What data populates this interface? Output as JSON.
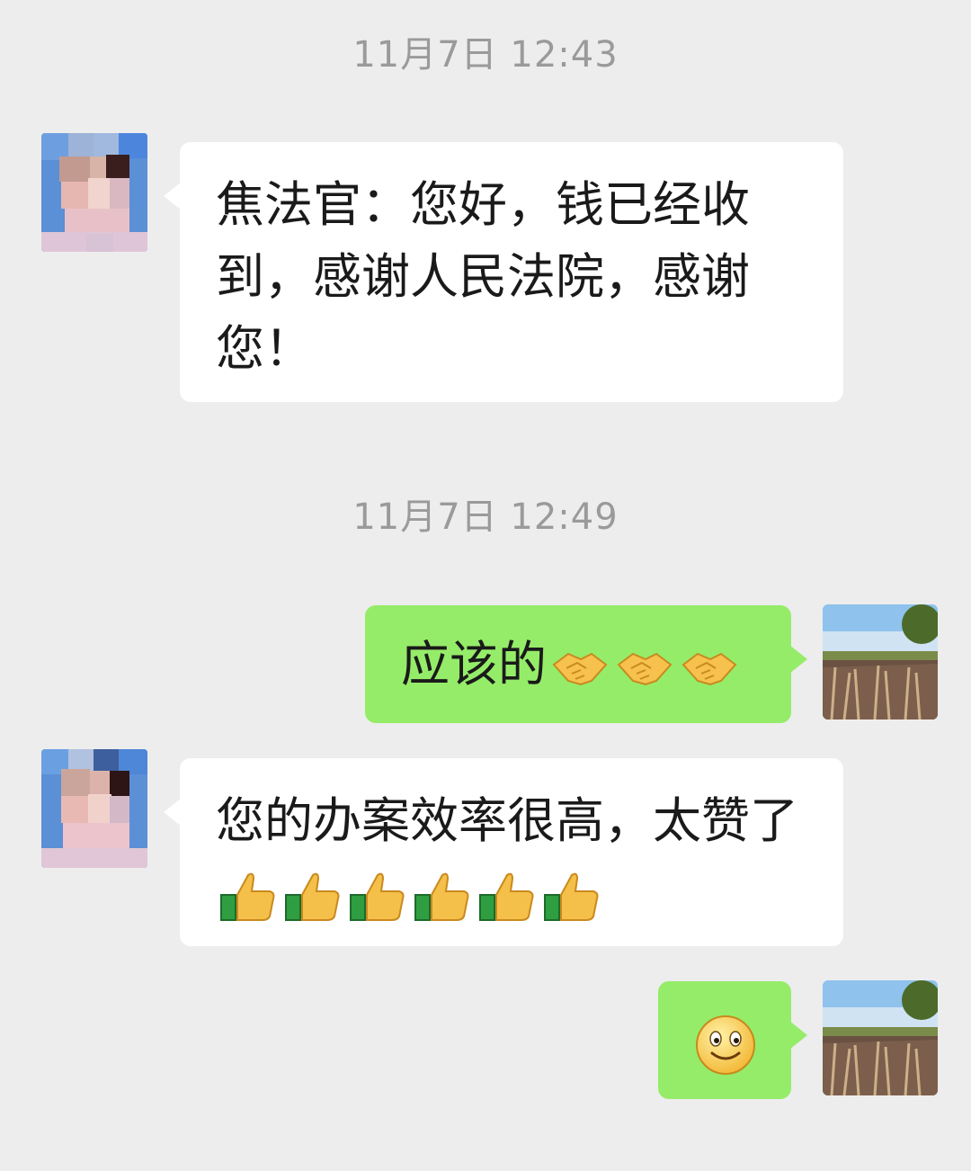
{
  "messages": {
    "ts1": "11月7日 12:43",
    "msg1": "焦法官：您好，钱已经收到，感谢人民法院，感谢您！",
    "ts2": "11月7日 12:49",
    "msg2": "应该的",
    "msg2_emoji": "handshake-emoji x3",
    "msg3": "您的办案效率很高，太赞了",
    "msg3_emoji": "thumbs-up-emoji x6",
    "msg4_emoji": "smiley-emoji"
  },
  "colors": {
    "background": "#ededed",
    "incoming_bubble": "#ffffff",
    "outgoing_bubble": "#95ec69",
    "timestamp": "#9a9a9a"
  }
}
